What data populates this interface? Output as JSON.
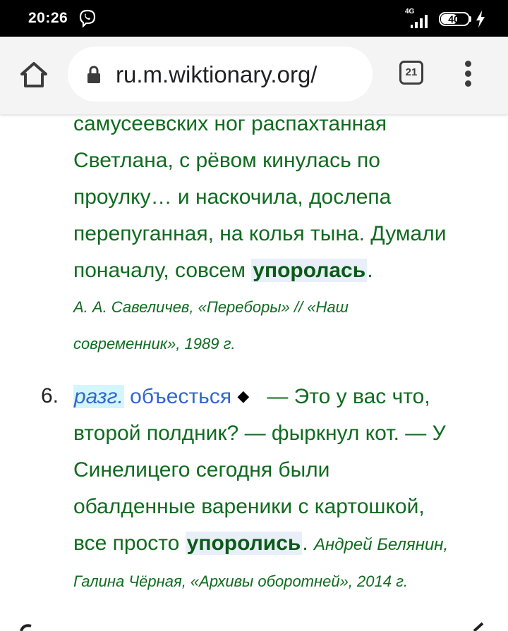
{
  "status_bar": {
    "time": "20:26",
    "network": "4G",
    "battery": "40",
    "icons": [
      "viber-icon",
      "signal-icon",
      "battery-icon",
      "charging-icon"
    ]
  },
  "browser": {
    "url": "ru.m.wiktionary.org/",
    "tab_count": "21",
    "icons": [
      "home-icon",
      "lock-icon",
      "tabs-icon",
      "menu-icon"
    ]
  },
  "quote": {
    "line1": "самусеевских ног распахтанная",
    "line2": "Светлана, с рёвом кинулась по",
    "line3": "проулку… и наскочила, дослепа",
    "line4": "перепуганная, на колья тына. Думали",
    "line5_pre": "поначалу, совсем ",
    "line5_hl": "упоролась",
    "line5_post": ".",
    "cite1": "А. А. Савеличев, «Переборы» // «Наш",
    "cite2": "современник», 1989 г."
  },
  "definition6": {
    "number": "6.",
    "label": "разг.",
    "sep": " ",
    "link": "объесться",
    "diamond": "◆",
    "line1_rest": "— Это у вас что,",
    "line2": "второй полдник? — фыркнул кот. — У",
    "line3": "Синелицего сегодня были",
    "line4": "обалденные вареники с картошкой,",
    "line5_pre": "все просто ",
    "line5_hl": "упоролись",
    "line5_post": ".",
    "cite_a": "Андрей Белянин,",
    "cite_b": "Галина Чёрная, «Архивы оборотней», 2014 г."
  },
  "colors": {
    "example_text": "#0f6b1f",
    "link": "#3366cc",
    "highlight": "#e8eff9",
    "label_bg": "#d3f6fc",
    "toolbar_bg": "#f4f4f4"
  }
}
